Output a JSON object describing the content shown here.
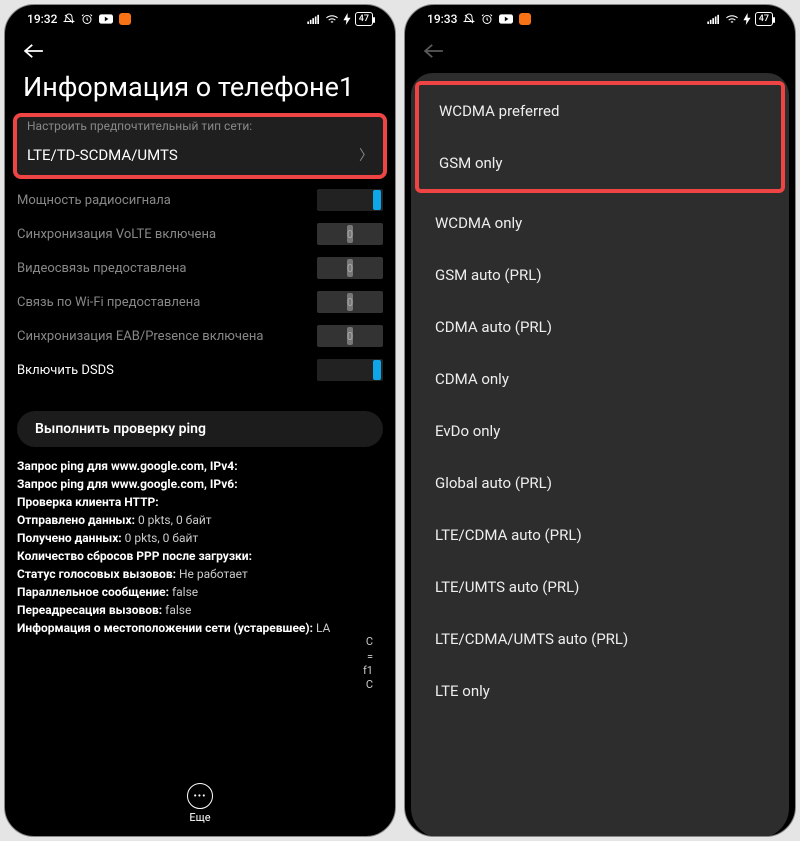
{
  "left": {
    "status": {
      "time": "19:32",
      "battery": "47"
    },
    "title": "Информация о телефоне1",
    "cutoff": "Настроить предпочтительный тип сети:",
    "network_value": "LTE/TD-SCDMA/UMTS",
    "settings": [
      {
        "label": "Мощность радиосигнала",
        "state": "on"
      },
      {
        "label": "Синхронизация VoLTE включена",
        "state": "off"
      },
      {
        "label": "Видеосвязь предоставлена",
        "state": "off"
      },
      {
        "label": "Связь по Wi-Fi предоставлена",
        "state": "off"
      },
      {
        "label": "Синхронизация EAB/Presence включена",
        "state": "off"
      },
      {
        "label": "Включить DSDS",
        "state": "on",
        "white": true
      }
    ],
    "ping_button": "Выполнить проверку ping",
    "info_lines": [
      {
        "b": "Запрос ping для www.google.com, IPv4:",
        "v": ""
      },
      {
        "b": "Запрос ping для www.google.com, IPv6:",
        "v": ""
      },
      {
        "b": "Проверка клиента HTTP:",
        "v": ""
      },
      {
        "b": "Отправлено данных:",
        "v": " 0 pkts, 0 байт"
      },
      {
        "b": "Получено данных:",
        "v": " 0 pkts, 0 байт"
      },
      {
        "b": "Количество сбросов PPP после загрузки:",
        "v": ""
      },
      {
        "b": "Статус голосовых вызовов:",
        "v": " Не работает"
      },
      {
        "b": "Параллельное сообщение:",
        "v": " false"
      },
      {
        "b": "Переадресация вызовов:",
        "v": " false"
      },
      {
        "b": "Информация о местоположении сети (устаревшее):",
        "v": " LA"
      }
    ],
    "tail": [
      "C",
      "=",
      "f1",
      "C"
    ],
    "bottom_more": "Еще"
  },
  "right": {
    "status": {
      "time": "19:33",
      "battery": "47"
    },
    "highlighted": [
      "WCDMA preferred",
      "GSM only"
    ],
    "options": [
      "WCDMA only",
      "GSM auto (PRL)",
      "CDMA auto (PRL)",
      "CDMA only",
      "EvDo only",
      "Global auto (PRL)",
      "LTE/CDMA auto (PRL)",
      "LTE/UMTS auto (PRL)",
      "LTE/CDMA/UMTS auto (PRL)",
      "LTE only"
    ]
  }
}
